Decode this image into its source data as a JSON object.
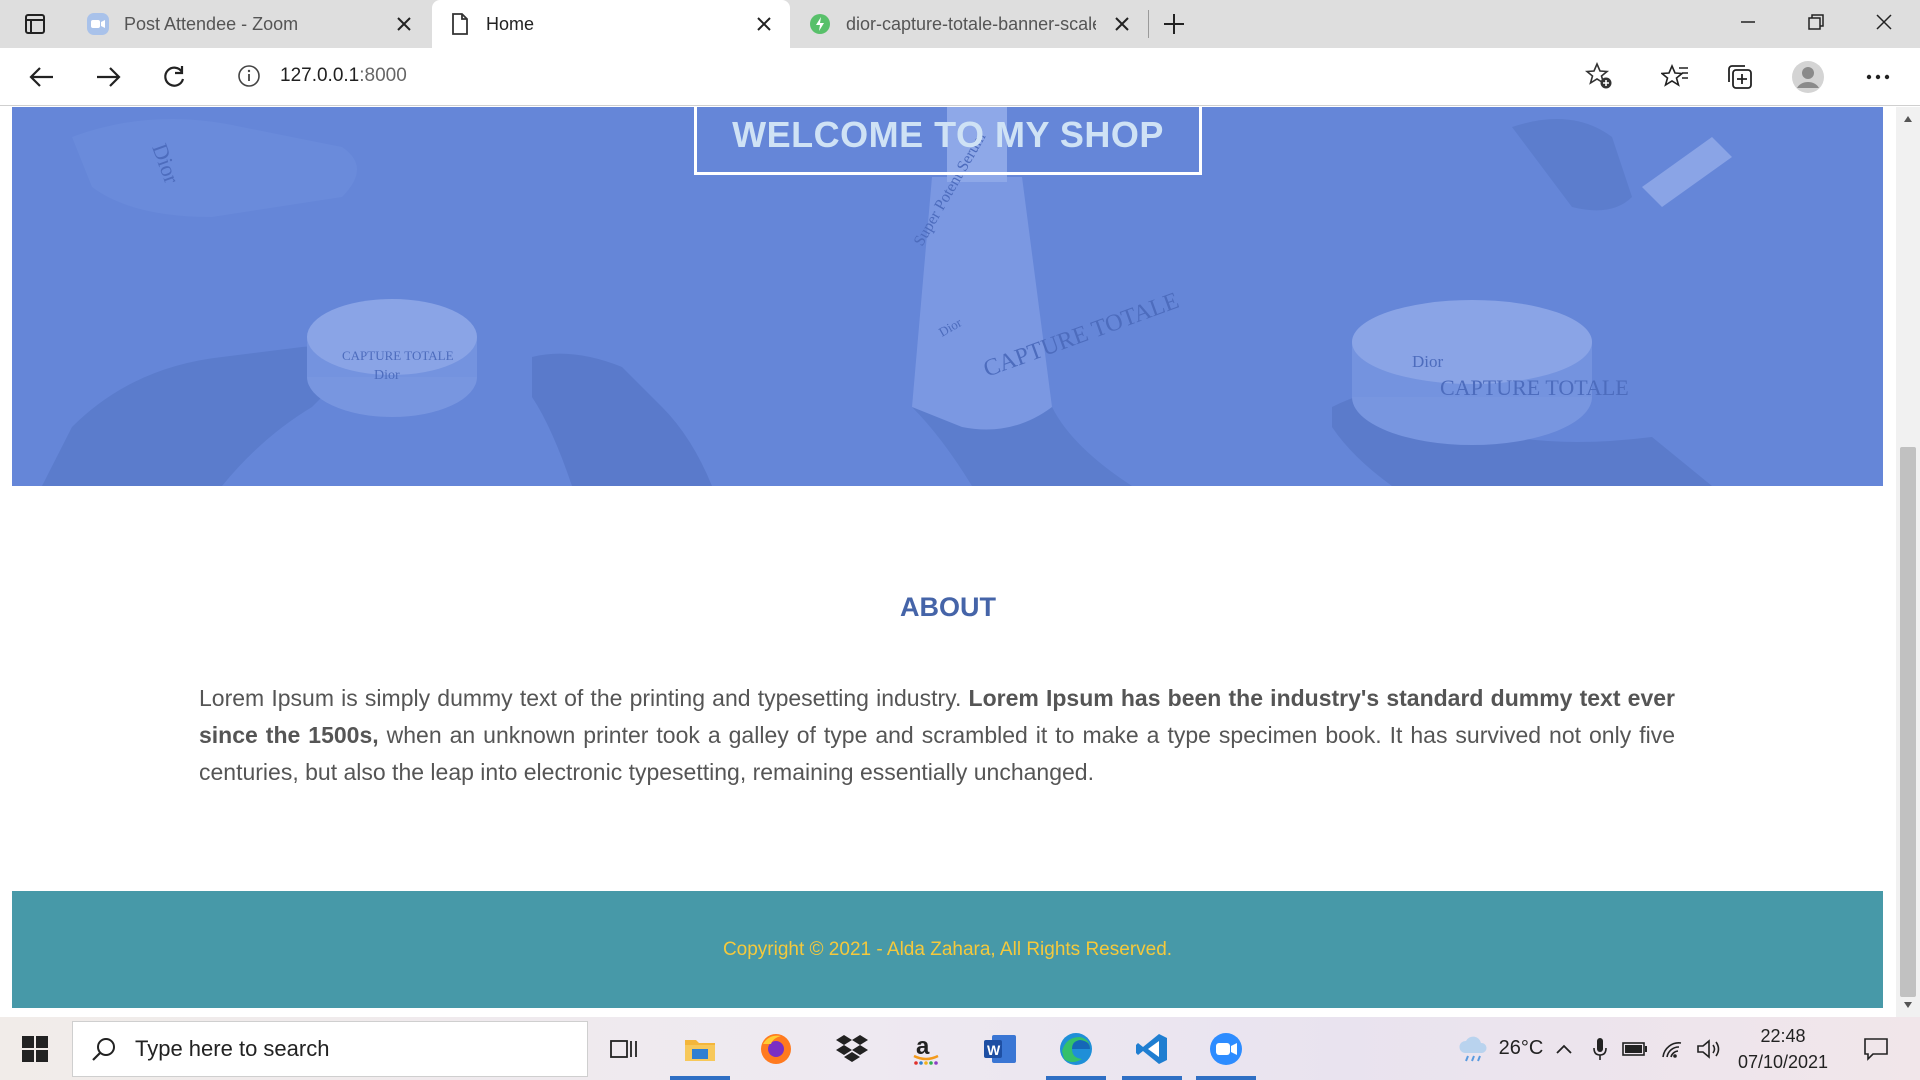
{
  "browser": {
    "tabs": [
      {
        "label": "Post Attendee - Zoom",
        "icon": "zoom-icon"
      },
      {
        "label": "Home",
        "icon": "page-icon"
      },
      {
        "label": "dior-capture-totale-banner-scale",
        "icon": "image-icon"
      }
    ],
    "address": {
      "host": "127.0.0.1",
      "port": ":8000"
    }
  },
  "hero": {
    "title": "WELCOME TO MY SHOP",
    "overlay_color": "#6586d8",
    "photo_labels": [
      "Dior",
      "CAPTURE TOTALE",
      "Super Potent Serum",
      "Dior",
      "CAPTURE TOTALE",
      "Dior",
      "CAPTURE TOTALE",
      "Dior"
    ]
  },
  "about": {
    "title": "ABOUT",
    "text_part1": "Lorem Ipsum is simply dummy text of the printing and typesetting industry. ",
    "text_bold": "Lorem Ipsum has been the industry's standard dummy text ever since the 1500s,",
    "text_part2": " when an unknown printer took a galley of type and scrambled it to make a type specimen book. It has survived not only five centuries, but also the leap into electronic typesetting, remaining essentially unchanged."
  },
  "footer": {
    "copyright": "Copyright © 2021 - Alda Zahara, All Rights Reserved."
  },
  "taskbar": {
    "search_placeholder": "Type here to search",
    "apps": [
      "task-view-icon",
      "file-explorer-icon",
      "firefox-icon",
      "dropbox-icon",
      "amazon-icon",
      "word-icon",
      "edge-icon",
      "vscode-icon",
      "zoom-icon"
    ],
    "temperature": "26°C",
    "time": "22:48",
    "date": "07/10/2021"
  },
  "colors": {
    "accent_blue": "#4564a8",
    "footer_bg": "#4799a8",
    "footer_text": "#f5c93c"
  }
}
